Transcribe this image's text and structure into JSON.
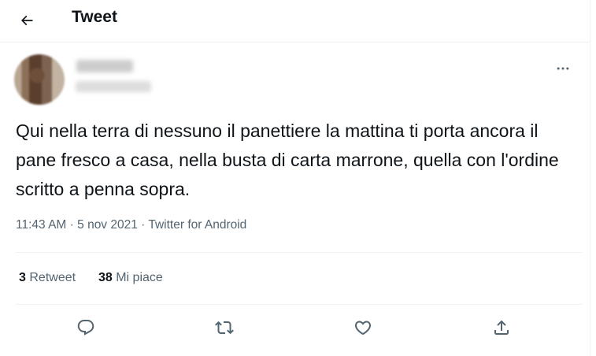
{
  "header": {
    "title": "Tweet"
  },
  "tweet": {
    "author_name": "",
    "author_handle": "",
    "text": "Qui nella terra di nessuno il panettiere la mattina ti porta ancora il pane fresco a casa, nella busta di carta marrone, quella con l'ordine scritto a penna sopra.",
    "time": "11:43 AM",
    "date": "5 nov 2021",
    "separator": "·",
    "source": "Twitter for Android"
  },
  "stats": {
    "retweets": {
      "count": "3",
      "label": "Retweet"
    },
    "likes": {
      "count": "38",
      "label": "Mi piace"
    }
  },
  "icons": {
    "back": "arrow-left-icon",
    "more": "more-horizontal-icon",
    "reply": "reply-icon",
    "retweet": "retweet-icon",
    "like": "heart-icon",
    "share": "share-icon"
  },
  "colors": {
    "text_primary": "#0f1419",
    "text_secondary": "#536471",
    "divider": "#eff3f4",
    "background": "#ffffff"
  }
}
